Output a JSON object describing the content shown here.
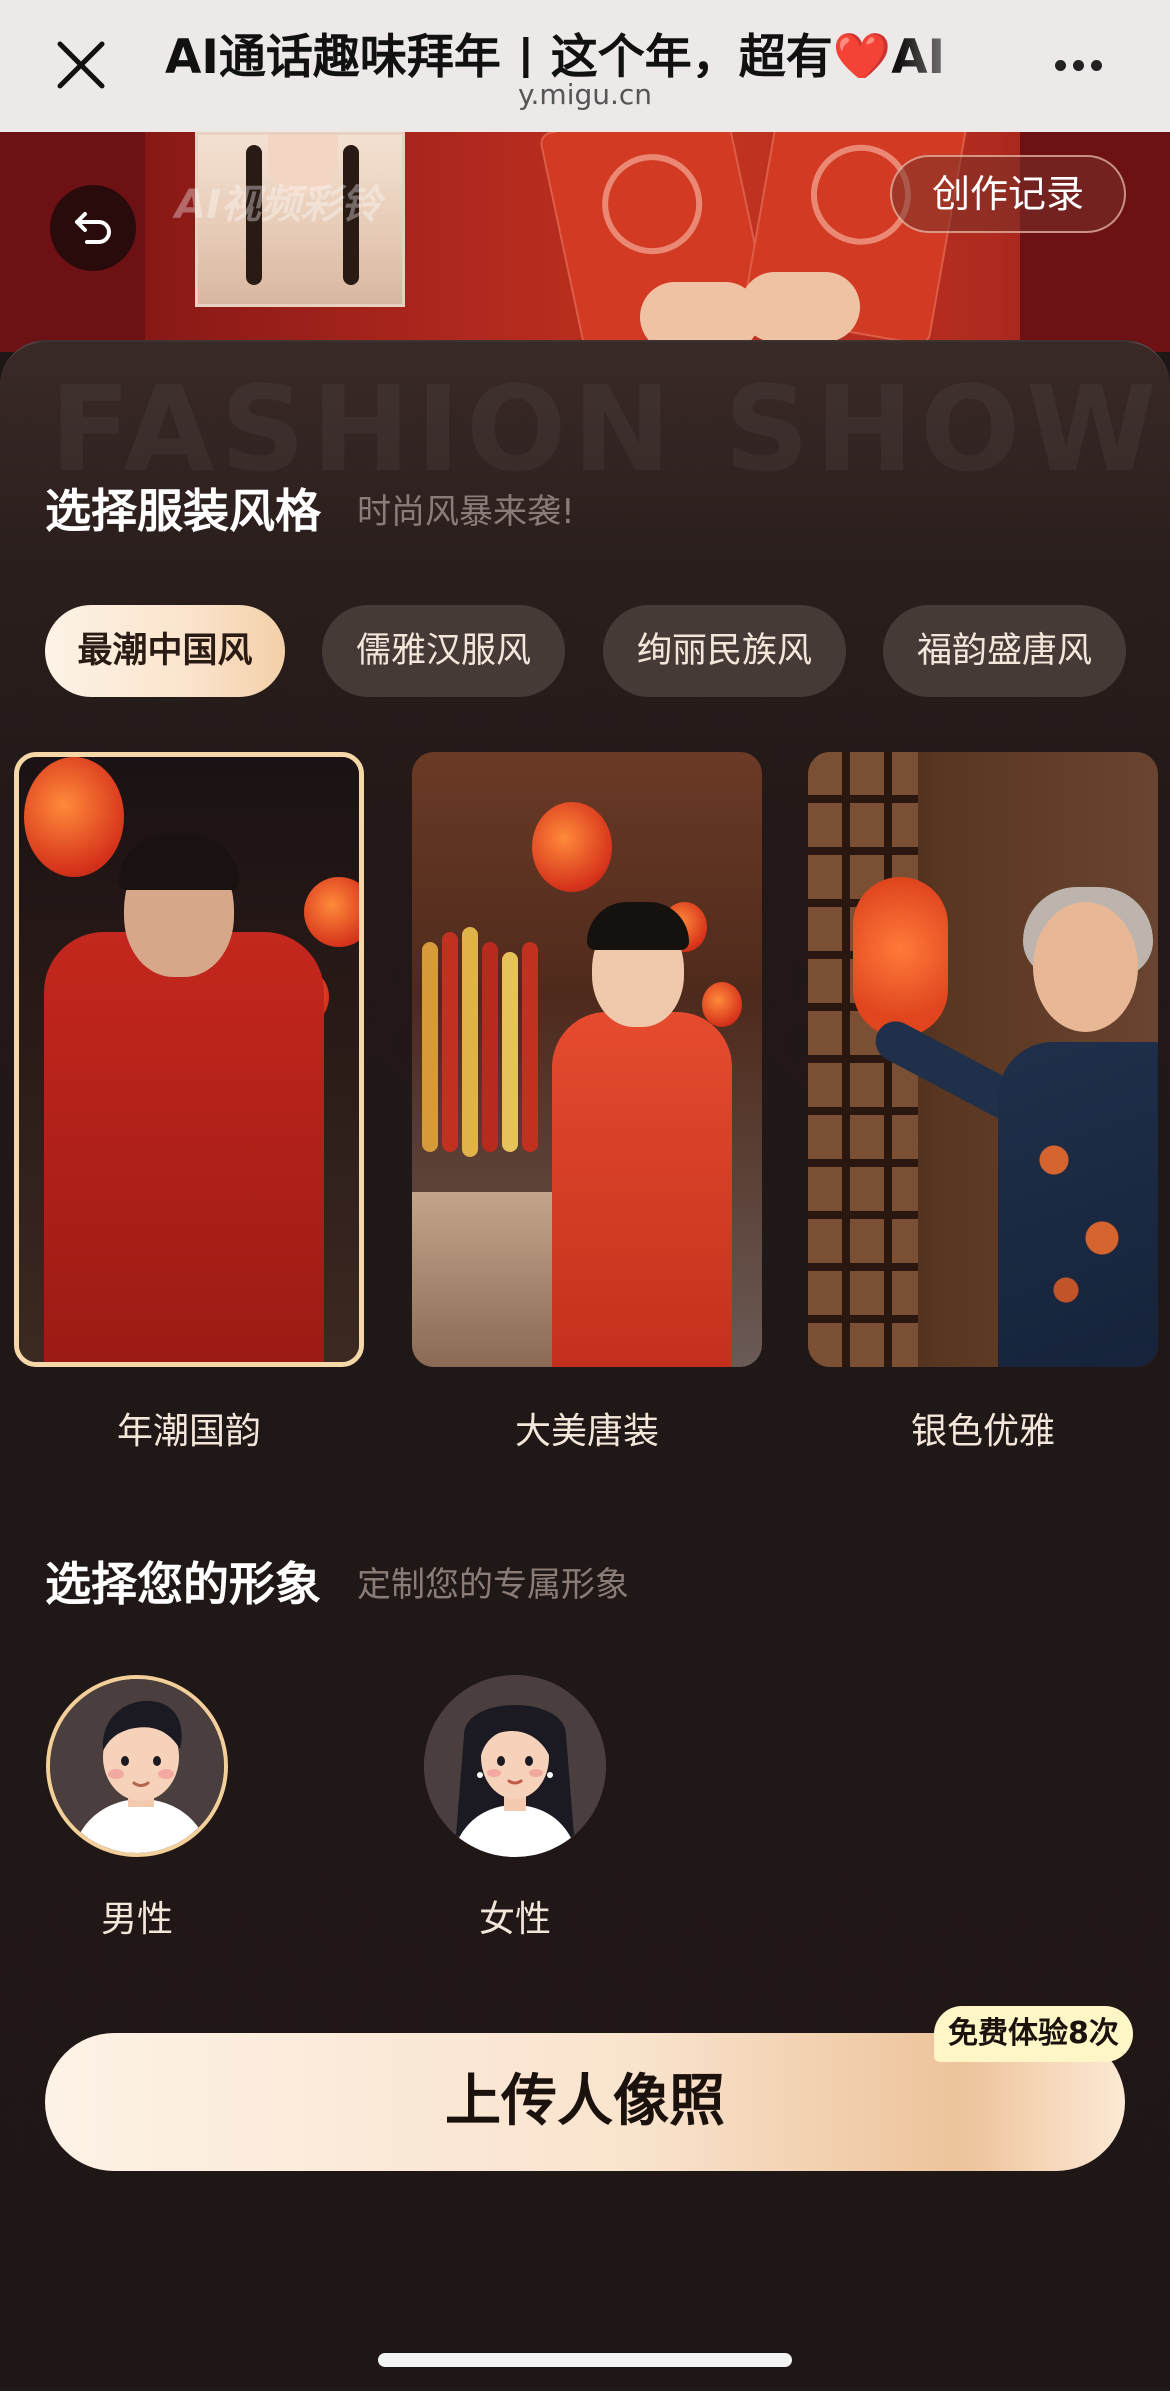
{
  "browser": {
    "title": "AI通话趣味拜年 | 这个年，超有❤️AI",
    "domain": "y.migu.cn",
    "close_icon": "close-icon",
    "more_icon": "more-icon"
  },
  "banner": {
    "watermark": "AI视频彩铃",
    "records_label": "创作记录",
    "back_icon": "back-arrow-icon"
  },
  "background_text": "FASHION SHOW",
  "style_section": {
    "title": "选择服装风格",
    "subtitle": "时尚风暴来袭!",
    "tabs": [
      {
        "label": "最潮中国风",
        "active": true
      },
      {
        "label": "儒雅汉服风",
        "active": false
      },
      {
        "label": "绚丽民族风",
        "active": false
      },
      {
        "label": "福韵盛唐风",
        "active": false
      }
    ],
    "cards": [
      {
        "label": "年潮国韵",
        "selected": true
      },
      {
        "label": "大美唐装",
        "selected": false
      },
      {
        "label": "银色优雅",
        "selected": false
      }
    ]
  },
  "avatar_section": {
    "title": "选择您的形象",
    "subtitle": "定制您的专属形象",
    "options": [
      {
        "label": "男性",
        "selected": true,
        "icon": "male-avatar-icon"
      },
      {
        "label": "女性",
        "selected": false,
        "icon": "female-avatar-icon"
      }
    ]
  },
  "cta": {
    "label": "上传人像照",
    "badge": "免费体验8次"
  },
  "colors": {
    "accent": "#f6d8a8",
    "background": "#1f1716",
    "banner_red": "#b0281e"
  }
}
